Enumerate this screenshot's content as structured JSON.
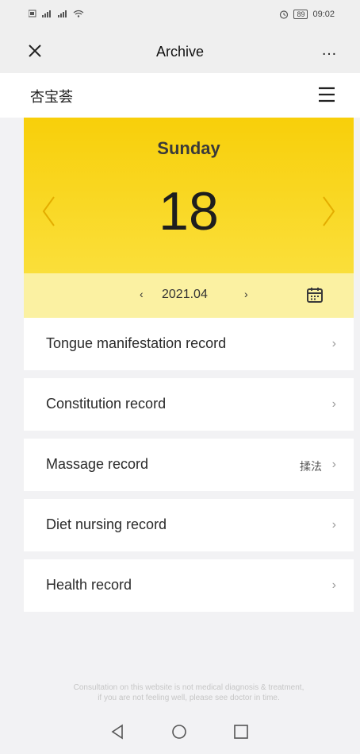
{
  "status_bar": {
    "signal_text": "â âª",
    "time": "09:02",
    "battery": "89"
  },
  "nav": {
    "title": "Archive",
    "more_label": "…"
  },
  "brand": {
    "name": "杏宝荟"
  },
  "date_panel": {
    "weekday": "Sunday",
    "day": "18",
    "month": "2021.04"
  },
  "records": [
    {
      "label": "Tongue manifestation record",
      "value": ""
    },
    {
      "label": "Constitution record",
      "value": ""
    },
    {
      "label": "Massage record",
      "value": "揉法"
    },
    {
      "label": "Diet nursing record",
      "value": ""
    },
    {
      "label": "Health record",
      "value": ""
    }
  ],
  "disclaimer": {
    "line1": "Consultation on this website is not medical diagnosis & treatment,",
    "line2": "if you are not feeling well, please see doctor in time."
  },
  "colors": {
    "accent_yellow": "#f8cf0a",
    "light_yellow": "#fbf1a2",
    "background": "#f2f2f4"
  },
  "icons": [
    "close-icon",
    "more-icon",
    "menu-icon",
    "calendar-icon",
    "chevron-left-icon",
    "chevron-right-icon",
    "chevron-icon",
    "back-icon",
    "home-icon",
    "recents-icon"
  ]
}
